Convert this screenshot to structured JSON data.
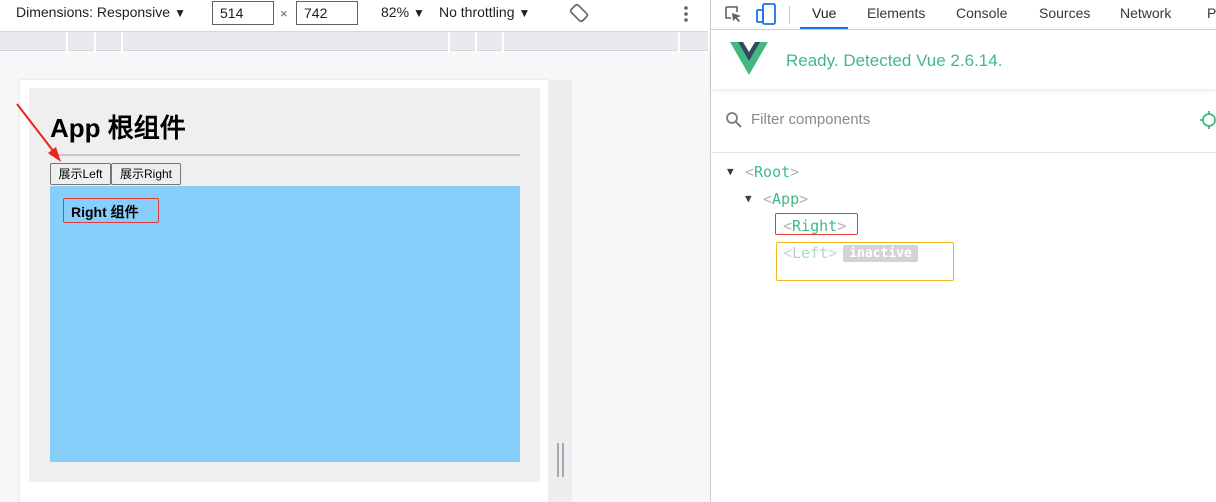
{
  "device_toolbar": {
    "dimensions_label": "Dimensions: Responsive",
    "width_value": "514",
    "height_value": "742",
    "times_symbol": "×",
    "zoom_label": "82%",
    "throttle_label": "No throttling",
    "caret": "▼"
  },
  "page": {
    "title": "App 根组件",
    "show_left_button": "展示Left",
    "show_right_button": "展示Right",
    "right_component_title": "Right 组件"
  },
  "devtools": {
    "tabs": [
      "Vue",
      "Elements",
      "Console",
      "Sources",
      "Network",
      "Pe"
    ],
    "active_tab": "Vue",
    "accent_color": "#1a73e8"
  },
  "vue_panel": {
    "status": "Ready. Detected Vue 2.6.14.",
    "filter_placeholder": "Filter components",
    "brand_color": "#42b983",
    "tree": {
      "root": "Root",
      "app": "App",
      "right": "Right",
      "left": "Left",
      "inactive_badge": "inactive"
    }
  },
  "colors": {
    "right_component_bg": "#87cefa",
    "selected_outline": "#e03a3a",
    "inactive_outline": "#f3b51b"
  }
}
